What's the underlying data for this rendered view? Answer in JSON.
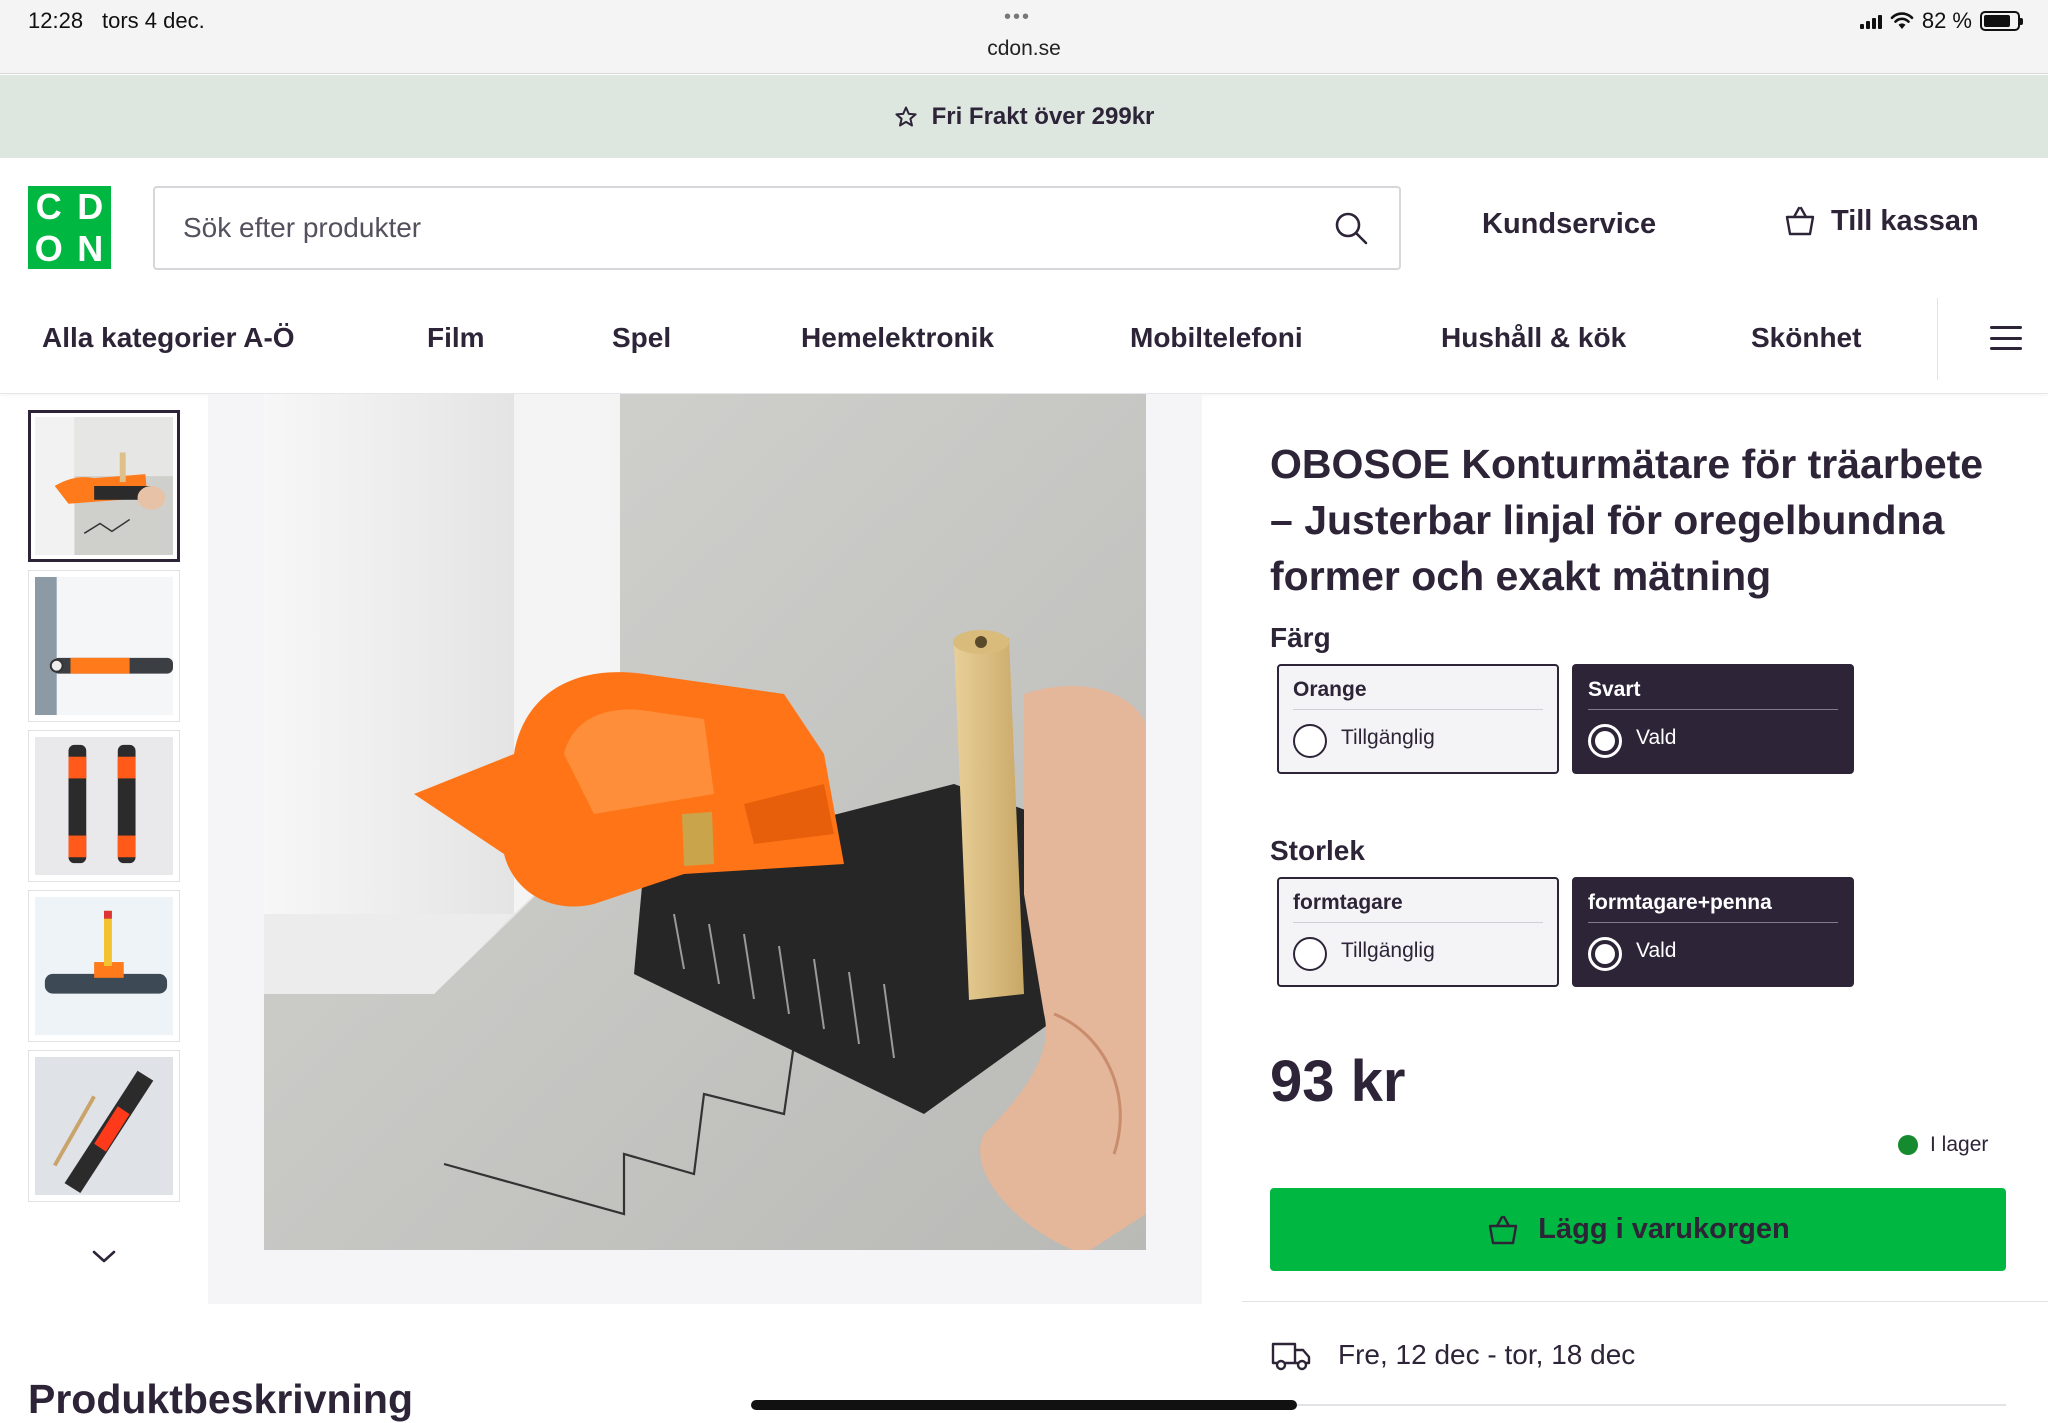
{
  "status_bar": {
    "time": "12:28",
    "date": "tors 4 dec.",
    "url": "cdon.se",
    "battery": "82 %",
    "battery_level": 0.82
  },
  "promo": {
    "text": "Fri Frakt över 299kr",
    "icon": "star-icon"
  },
  "header": {
    "logo_letters": [
      "C",
      "D",
      "O",
      "N"
    ],
    "search_placeholder": "Sök efter produkter",
    "customer_service": "Kundservice",
    "checkout": "Till kassan"
  },
  "nav": {
    "items": [
      {
        "label": "Alla kategorier A-Ö"
      },
      {
        "label": "Film"
      },
      {
        "label": "Spel"
      },
      {
        "label": "Hemelektronik"
      },
      {
        "label": "Mobiltelefoni"
      },
      {
        "label": "Hushåll & kök"
      },
      {
        "label": "Skönhet"
      }
    ]
  },
  "product": {
    "title": "OBOSOE Konturmätare för träarbete – Justerbar linjal för oregelbundna former och exakt mätning",
    "color_label": "Färg",
    "color_options": [
      {
        "name": "Orange",
        "status": "Tillgänglig",
        "selected": false
      },
      {
        "name": "Svart",
        "status": "Vald",
        "selected": true
      }
    ],
    "size_label": "Storlek",
    "size_options": [
      {
        "name": "formtagare",
        "status": "Tillgänglig",
        "selected": false
      },
      {
        "name": "formtagare+penna",
        "status": "Vald",
        "selected": true
      }
    ],
    "price": "93 kr",
    "stock": "I lager",
    "add_to_cart": "Lägg i varukorgen",
    "delivery": "Fre, 12 dec - tor, 18 dec"
  },
  "description_heading": "Produktbeskrivning",
  "colors": {
    "brand_green": "#00b741",
    "dark": "#2d2438",
    "promo_bg": "#dde7e0",
    "stock_green": "#168a2e"
  }
}
